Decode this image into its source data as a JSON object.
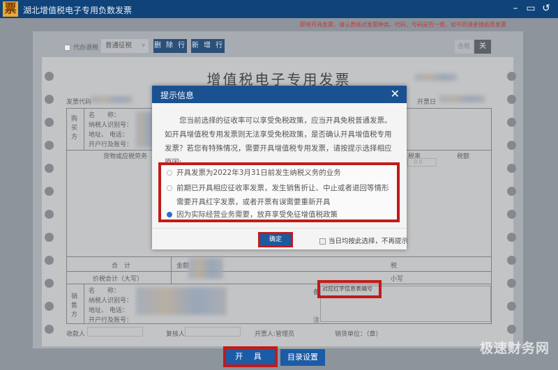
{
  "window": {
    "title": "湖北增值税电子专用负数发票",
    "logo_char": "票",
    "icons": [
      "minimize-icon",
      "restore-icon",
      "back-icon"
    ]
  },
  "notice": "即将开具发票，请认真核对发票种类、代码、号码是否一致，如不同请更换纸质发票",
  "toolbar": {
    "agent_refund_label": "代办退税",
    "tax_type": "普通征税",
    "delete_row": "删 除 行",
    "add_row": "新 增 行",
    "tax_inclusive": "含税",
    "toggle": "关"
  },
  "invoice": {
    "title": "增值税电子专用发票",
    "code_label": "发票代码",
    "date_label": "开票日",
    "buyer": {
      "side_label": "购买方",
      "fields": [
        "名　　称：",
        "纳税人识别号：",
        "地址、 电话：",
        "开户行及账号："
      ]
    },
    "items_header": {
      "name": "货物或应税劳务",
      "rate": "税率",
      "tax": "税额"
    },
    "rate_value": "0.0",
    "total_label": "合　计",
    "amount_label": "金额",
    "tax_label": "税",
    "total_in_words": "价税合计（大写）",
    "small_label": "小写",
    "seller": {
      "side_label": "销售方",
      "fields": [
        "名　　称：",
        "纳税人识别号：",
        "地址、 电话：",
        "开户行及账号："
      ]
    },
    "remark_prefix": "备",
    "remark_note": "注",
    "red_info_label": "对应红字信息表编号",
    "payee_label": "收款人",
    "reviewer_label": "复核人",
    "drawer_label": "开票人:管理员",
    "seller_unit_label": "销货单位：（章）"
  },
  "dialog": {
    "title": "提示信息",
    "message": "您当前选择的征收率可以享受免税政策，应当开具免税普通发票。如开具增值税专用发票则无法享受免税政策，是否确认开具增值税专用发票？若您有特殊情况，需要开具增值税专用发票，请按提示选择相应原因:",
    "options": [
      {
        "label": "开具发票为2022年3月31日前发生纳税义务的业务",
        "selected": false
      },
      {
        "label": "前期已开具相应征收率发票，发生销售折让、中止或者退回等情形需要开具红字发票，或者开票有误需要重新开具",
        "selected": false
      },
      {
        "label": "因为实际经营业务需要，放弃享受免征增值税政策",
        "selected": true
      }
    ],
    "ok": "确定",
    "remember": "当日均按此选择，不再提示"
  },
  "footer": {
    "issue": "开 具",
    "directory": "目录设置"
  },
  "watermark": "极速财务网",
  "colors": {
    "titlebar": "#0f4379",
    "highlight": "#c21a1a",
    "button": "#1c5ba6"
  }
}
